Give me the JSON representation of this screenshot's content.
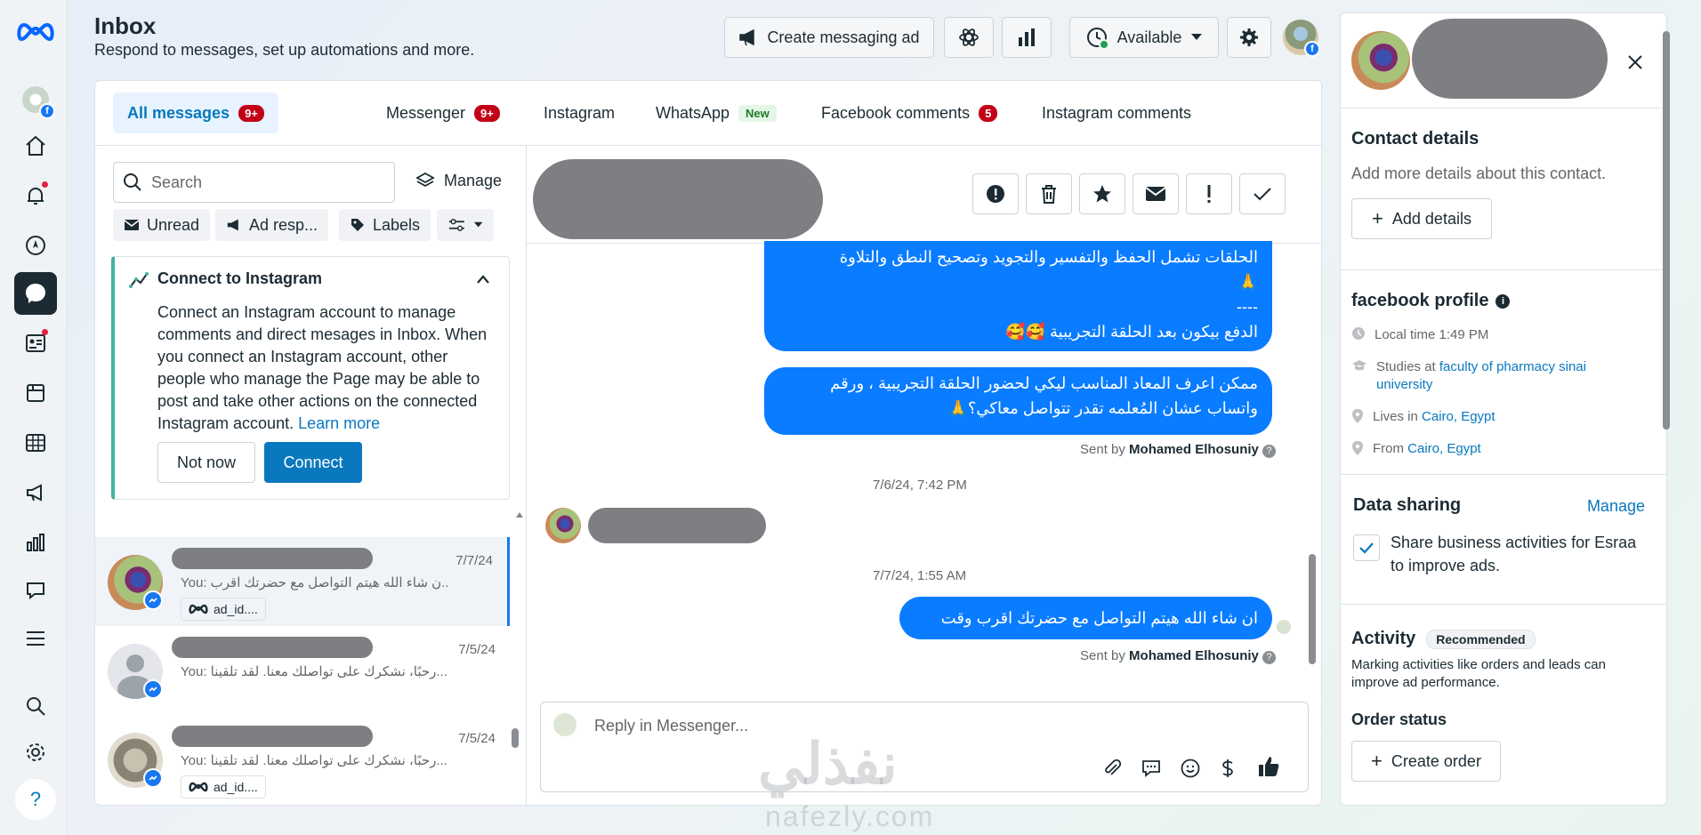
{
  "header": {
    "title": "Inbox",
    "subtitle": "Respond to messages, set up automations and more.",
    "create_ad_label": "Create messaging ad",
    "status_label": "Available"
  },
  "tabs": [
    {
      "label": "All messages",
      "badge": "9+"
    },
    {
      "label": "Messenger",
      "badge": "9+"
    },
    {
      "label": "Instagram"
    },
    {
      "label": "WhatsApp",
      "badge": "New"
    },
    {
      "label": "Facebook comments",
      "badge": "5"
    },
    {
      "label": "Instagram comments"
    }
  ],
  "list": {
    "search_placeholder": "Search",
    "manage_label": "Manage",
    "filters": [
      "Unread",
      "Ad resp...",
      "Labels"
    ],
    "connect_card": {
      "title": "Connect to Instagram",
      "body": "Connect an Instagram account to manage comments and direct mesages in Inbox. When you connect an Instagram account, other people who manage the Page may be able to post and take other actions on the connected Instagram account.",
      "link": "Learn more",
      "not_now": "Not now",
      "connect": "Connect"
    },
    "conversations": [
      {
        "date": "7/7/24",
        "preview": "You: ن شاء الله هيتم التواصل مع حضرتك اقرب...",
        "ad": "ad_id...."
      },
      {
        "date": "7/5/24",
        "preview": "You: رحبًا، نشكرك على تواصلك معنا. لقد تلقينا...",
        "ad": ""
      },
      {
        "date": "7/5/24",
        "preview": "You: رحبًا، نشكرك على تواصلك معنا. لقد تلقينا...",
        "ad": "ad_id...."
      }
    ]
  },
  "thread": {
    "msg1_line1": "الحلقات تشمل الحفظ والتفسير والتجويد وتصحيح النطق والتلاوة",
    "msg1_line2": "🙏",
    "msg1_line3": "----",
    "msg1_line4": "الدفع بيكون بعد الحلقة التجريبية 🥰🥰",
    "msg2_line1": "ممكن اعرف المعاد المناسب ليكي لحضور الحلقة التجريبية ، ورقم",
    "msg2_line2": "واتساب عشان المُعلمه تقدر تتواصل معاكي؟🙏",
    "sent_by_prefix": "Sent by",
    "sender": "Mohamed Elhosuniy",
    "ts1": "7/6/24, 7:42 PM",
    "ts2": "7/7/24, 1:55 AM",
    "msg3": "ان شاء الله هيتم التواصل مع حضرتك اقرب وقت",
    "reply_placeholder": "Reply in Messenger..."
  },
  "contact": {
    "details_title": "Contact details",
    "details_sub": "Add more details about this contact.",
    "add_details": "Add details",
    "profile_title": "facebook profile",
    "local_time": "Local time 1:49 PM",
    "studies_prefix": "Studies at",
    "studies_link": "faculty of pharmacy sinai university",
    "lives_prefix": "Lives in",
    "lives_link": "Cairo, Egypt",
    "from_prefix": "From",
    "from_link": "Cairo, Egypt",
    "data_sharing": "Data sharing",
    "manage": "Manage",
    "share_text": "Share business activities for Esraa to improve ads.",
    "activity": "Activity",
    "recommended": "Recommended",
    "activity_sub": "Marking activities like orders and leads can improve ad performance.",
    "order_status": "Order status",
    "create_order": "Create order"
  },
  "watermark": {
    "arabic": "نفذلي",
    "latin": "nafezly.com"
  },
  "colors": {
    "accent": "#0a78be",
    "bubble": "#0a7cff",
    "badge": "#c20017"
  }
}
